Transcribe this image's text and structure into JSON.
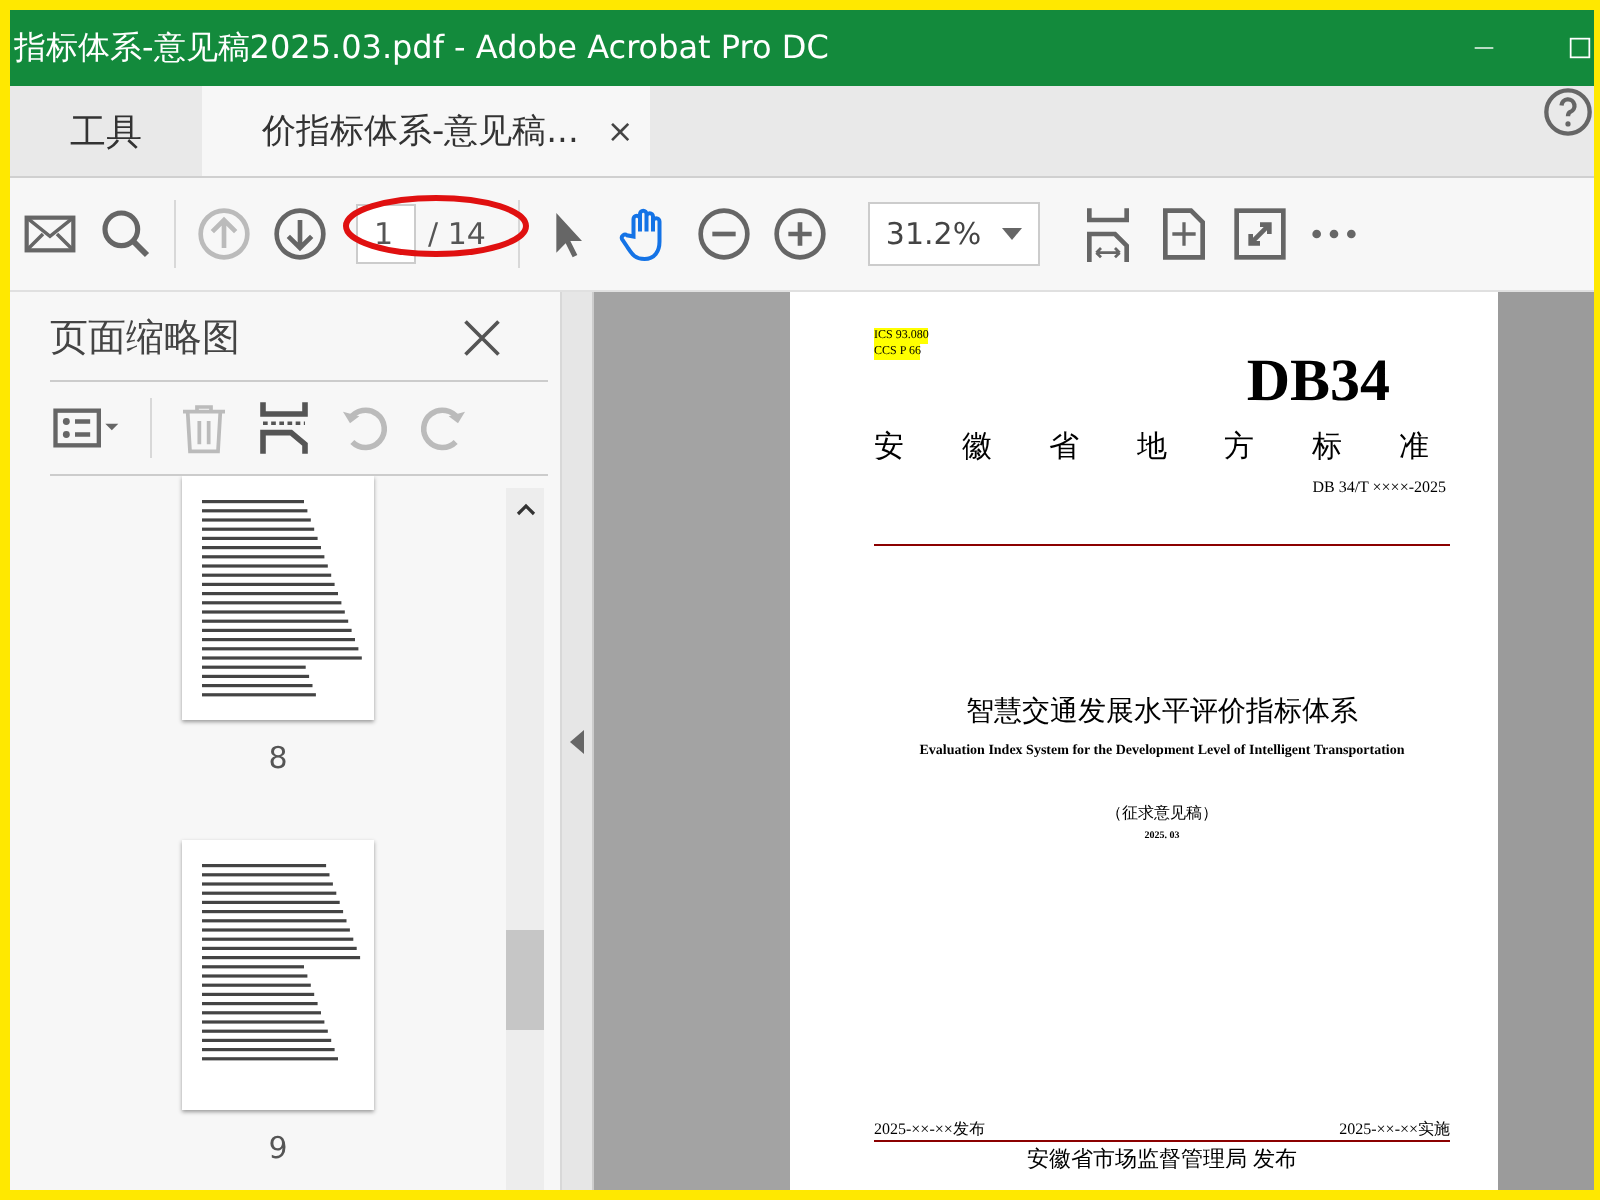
{
  "window": {
    "title": "指标体系-意见稿2025.03.pdf - Adobe Acrobat Pro DC"
  },
  "tabs": [
    {
      "label": "工具",
      "selected": false
    },
    {
      "label": "价指标体系-意见稿...",
      "selected": true,
      "close": "×"
    }
  ],
  "toolbar": {
    "page_number": "1",
    "page_total": "/ 14",
    "zoom": "31.2%"
  },
  "thumbnail_panel": {
    "title": "页面缩略图",
    "pages": [
      {
        "label": "8"
      },
      {
        "label": "9"
      }
    ]
  },
  "document": {
    "codes": [
      "ICS 93.080",
      "CCS P 66"
    ],
    "standard_code": "DB34",
    "heading": "安 徽 省 地 方 标 准",
    "number": "DB 34/T ××××-2025",
    "title": "智慧交通发展水平评价指标体系",
    "subtitle": "Evaluation Index System for the Development Level of Intelligent Transportation",
    "draft": "（征求意见稿）",
    "date": "2025. 03",
    "issued": "2025-××-××发布",
    "effective": "2025-××-××实施",
    "publisher": "安徽省市场监督管理局  发布"
  }
}
